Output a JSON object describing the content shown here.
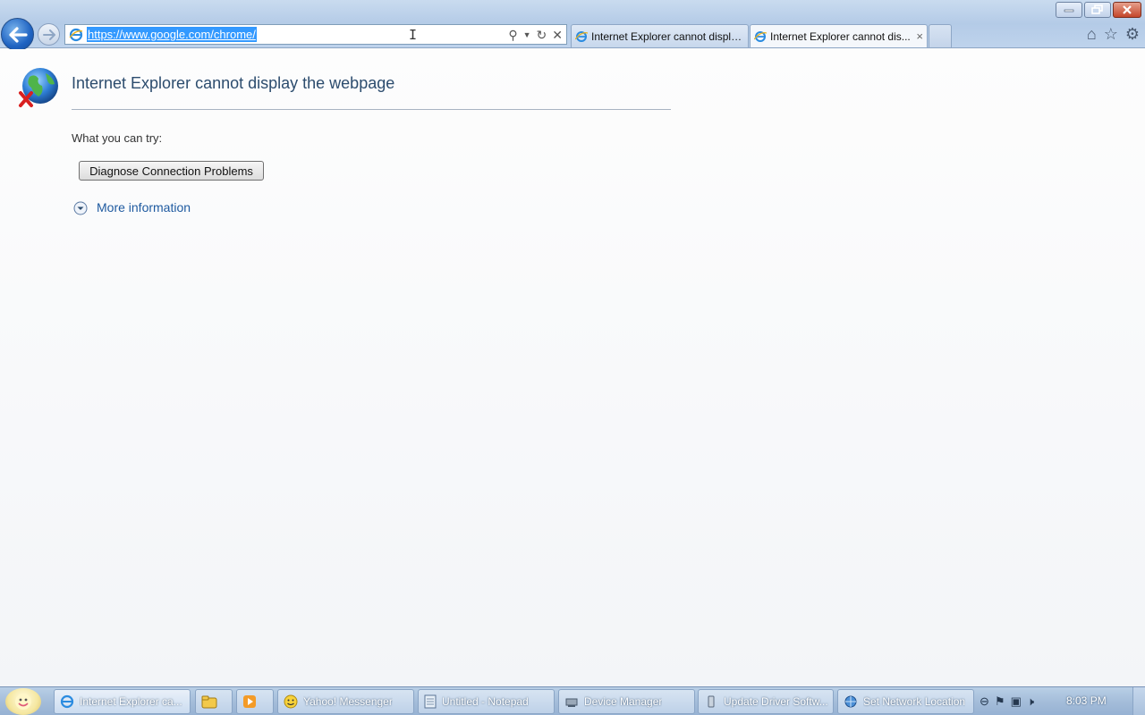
{
  "browser": {
    "url": "https://www.google.com/chrome/",
    "tabs": [
      {
        "title": "Internet Explorer cannot displa..."
      },
      {
        "title": "Internet Explorer cannot dis...",
        "close": "×"
      }
    ]
  },
  "page": {
    "error_title": "Internet Explorer cannot display the webpage",
    "try_label": "What you can try:",
    "diagnose_button": "Diagnose Connection Problems",
    "more_info": "More information"
  },
  "taskbar": {
    "items": [
      {
        "label": "Internet Explorer ca..."
      },
      {
        "label": "Yahoo! Messenger"
      },
      {
        "label": "Untitled - Notepad"
      },
      {
        "label": "Device Manager"
      },
      {
        "label": "Update Driver Softw..."
      },
      {
        "label": "Set Network Location"
      }
    ],
    "clock": "8:03 PM"
  },
  "colors": {
    "accent": "#3399ff",
    "title_text": "#2c4c6e",
    "link": "#1e5aa0"
  }
}
